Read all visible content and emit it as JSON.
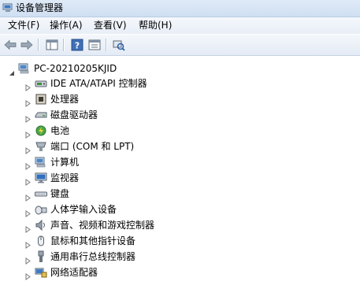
{
  "window": {
    "title": "设备管理器"
  },
  "menu": {
    "items": [
      {
        "label": "文件(F)"
      },
      {
        "label": "操作(A)"
      },
      {
        "label": "查看(V)"
      },
      {
        "label": "帮助(H)"
      }
    ]
  },
  "toolbar": {
    "buttons": [
      "back-arrow-icon",
      "forward-arrow-icon",
      "console-tree-icon",
      "help-icon",
      "properties-icon",
      "scan-hardware-icon"
    ]
  },
  "tree": {
    "root": {
      "label": "PC-20210205KJID",
      "icon": "computer-icon",
      "expanded": true
    },
    "items": [
      {
        "label": "IDE ATA/ATAPI 控制器",
        "icon": "ide-controller-icon"
      },
      {
        "label": "处理器",
        "icon": "processor-icon"
      },
      {
        "label": "磁盘驱动器",
        "icon": "disk-drive-icon"
      },
      {
        "label": "电池",
        "icon": "battery-icon"
      },
      {
        "label": "端口 (COM 和 LPT)",
        "icon": "port-icon"
      },
      {
        "label": "计算机",
        "icon": "computer-icon"
      },
      {
        "label": "监视器",
        "icon": "monitor-icon"
      },
      {
        "label": "键盘",
        "icon": "keyboard-icon"
      },
      {
        "label": "人体学输入设备",
        "icon": "hid-icon"
      },
      {
        "label": "声音、视频和游戏控制器",
        "icon": "sound-icon"
      },
      {
        "label": "鼠标和其他指针设备",
        "icon": "mouse-icon"
      },
      {
        "label": "通用串行总线控制器",
        "icon": "usb-icon"
      },
      {
        "label": "网络适配器",
        "icon": "network-adapter-icon"
      }
    ]
  },
  "colors": {
    "titlebar": "#dfeaf7",
    "menubar": "#eef3f9",
    "toolbar": "#e9eff7"
  }
}
